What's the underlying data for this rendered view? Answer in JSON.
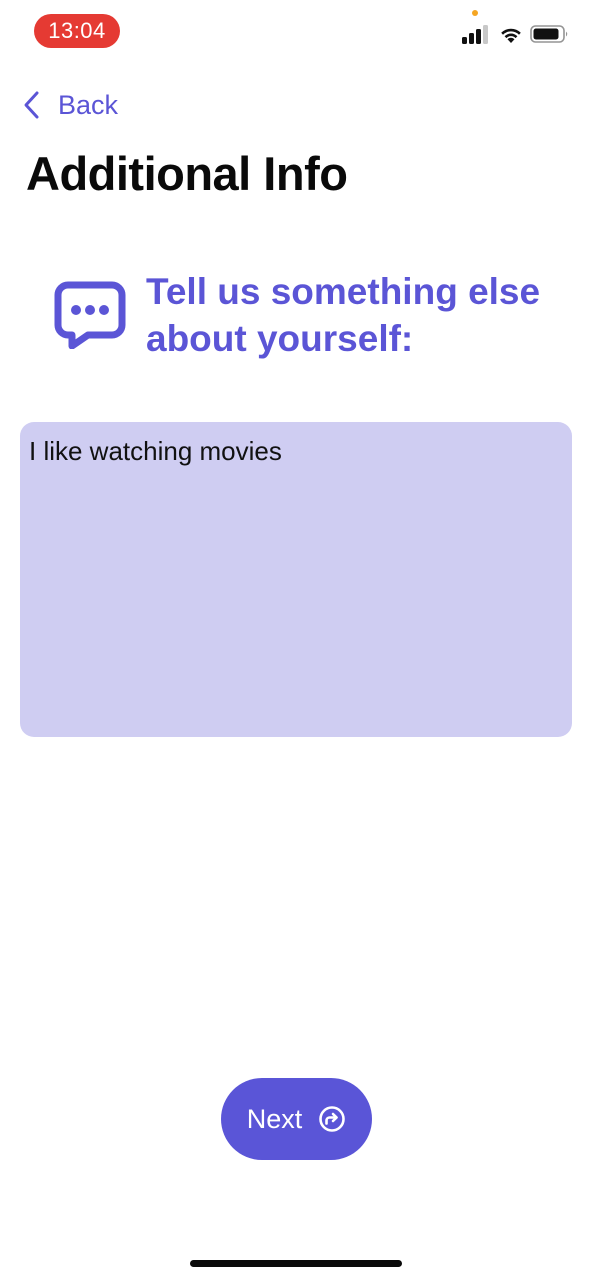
{
  "status_bar": {
    "time": "13:04",
    "icons": [
      "signal-icon",
      "wifi-icon",
      "battery-icon"
    ]
  },
  "nav": {
    "back_label": "Back"
  },
  "page": {
    "title": "Additional Info",
    "prompt": "Tell us something else about yourself:",
    "prompt_icon": "chat-bubble-icon"
  },
  "form": {
    "info_value": "I like watching movies"
  },
  "actions": {
    "next_label": "Next",
    "next_icon": "forward-arrow-circle-icon"
  },
  "colors": {
    "accent": "#5b55d6",
    "textarea_bg": "#cfcdf2",
    "time_pill": "#e53a33"
  }
}
